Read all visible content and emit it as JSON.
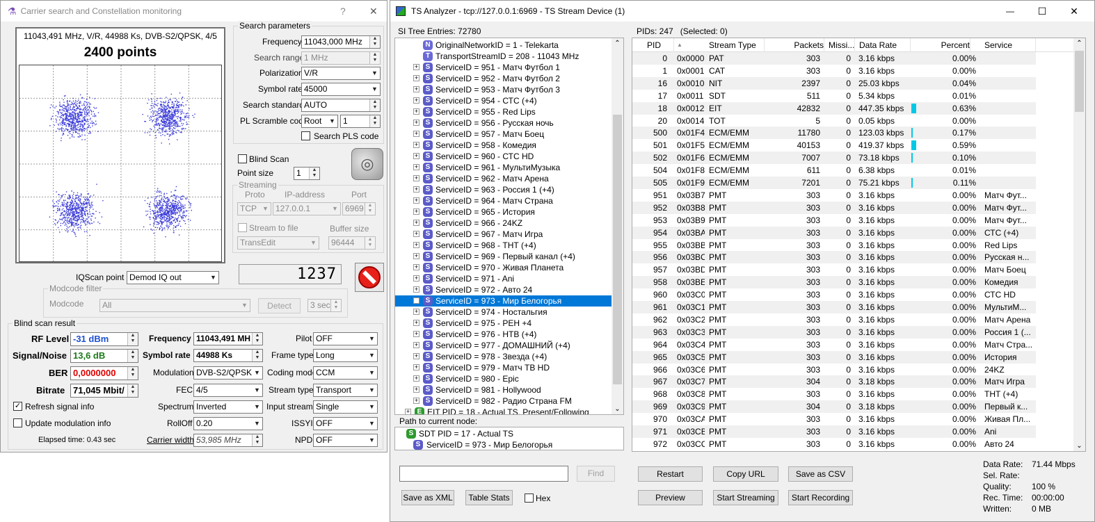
{
  "left": {
    "title": "Carrier search and Constellation monitoring",
    "help": "?",
    "close": "✕",
    "constellation": {
      "info": "11043,491 MHz, V/R, 44988 Ks, DVB-S2/QPSK, 4/5",
      "points": "2400 points"
    },
    "search": {
      "legend": "Search parameters",
      "frequency_label": "Frequency",
      "frequency_value": "11043,000 MHz",
      "range_label": "Search range",
      "range_value": "1 MHz",
      "polarization_label": "Polarization",
      "polarization_value": "V/R",
      "symbol_rate_label": "Symbol rate",
      "symbol_rate_value": "45000",
      "standard_label": "Search standard",
      "standard_value": "AUTO",
      "pl_label": "PL Scramble code",
      "pl_mode": "Root",
      "pl_value": "1",
      "pls_label": "Search PLS code"
    },
    "blind_scan_label": "Blind Scan",
    "point_size_label": "Point size",
    "point_size_value": "1",
    "streaming": {
      "legend": "Streaming",
      "proto_label": "Proto",
      "ip_label": "IP-address",
      "port_label": "Port",
      "proto_value": "TCP",
      "ip_value": "127.0.0.1",
      "port_value": "6969",
      "stream_to_file_label": "Stream to file",
      "buffer_label": "Buffer size",
      "file_value": "TransEdit",
      "buffer_value": "96444"
    },
    "counter": "1237",
    "iqscan_label": "IQScan point",
    "iqscan_value": "Demod IQ out",
    "modcode": {
      "legend": "Modcode filter",
      "label": "Modcode",
      "value": "All",
      "detect": "Detect",
      "secs": "3 sec"
    },
    "result": {
      "legend": "Blind scan result",
      "rf_label": "RF Level",
      "rf_value": "-31 dBm",
      "snr_label": "Signal/Noise",
      "snr_value": "13,6 dB",
      "ber_label": "BER",
      "ber_value": "0,0000000",
      "bitrate_label": "Bitrate",
      "bitrate_value": "71,045 Mbit/",
      "freq_label": "Frequency",
      "freq_value": "11043,491 MH",
      "sr_label": "Symbol rate",
      "sr_value": "44988 Ks",
      "mod_label": "Modulation",
      "mod_value": "DVB-S2/QPSK",
      "fec_label": "FEC",
      "fec_value": "4/5",
      "spectrum_label": "Spectrum",
      "spectrum_value": "Inverted",
      "rolloff_label": "RollOff",
      "rolloff_value": "0.20",
      "width_label": "Carrier width",
      "width_value": "53,985 MHz",
      "pilot_label": "Pilot",
      "pilot_value": "OFF",
      "frame_label": "Frame type",
      "frame_value": "Long",
      "coding_label": "Coding mode",
      "coding_value": "CCM",
      "stype_label": "Stream type",
      "stype_value": "Transport",
      "input_label": "Input stream",
      "input_value": "Single",
      "issyi_label": "ISSYI",
      "issyi_value": "OFF",
      "npd_label": "NPD",
      "npd_value": "OFF",
      "refresh_label": "Refresh signal info",
      "update_label": "Update modulation info",
      "elapsed": "Elapsed time: 0.43 sec"
    }
  },
  "right": {
    "title": "TS Analyzer - tcp://127.0.0.1:6969 - TS Stream Device (1)",
    "minimize": "—",
    "maximize": "☐",
    "close": "✕",
    "tree_header": "SI Tree Entries: 72780",
    "pids_header": "PIDs: 247   (Selected: 0)",
    "tree": [
      {
        "icon": "N",
        "text": "OriginalNetworkID = 1 - Telekarta",
        "exp": false
      },
      {
        "icon": "T",
        "text": "TransportStreamID = 208 - 11043 MHz",
        "exp": false
      },
      {
        "icon": "S",
        "text": "ServiceID = 951 - Матч Футбол 1",
        "exp": true
      },
      {
        "icon": "S",
        "text": "ServiceID = 952 - Матч Футбол 2",
        "exp": true
      },
      {
        "icon": "S",
        "text": "ServiceID = 953 - Матч Футбол 3",
        "exp": true
      },
      {
        "icon": "S",
        "text": "ServiceID = 954 - СТС (+4)",
        "exp": true
      },
      {
        "icon": "S",
        "text": "ServiceID = 955 - Red Lips",
        "exp": true
      },
      {
        "icon": "S",
        "text": "ServiceID = 956 - Русская ночь",
        "exp": true
      },
      {
        "icon": "S",
        "text": "ServiceID = 957 - Матч Боец",
        "exp": true
      },
      {
        "icon": "S",
        "text": "ServiceID = 958 - Комедия",
        "exp": true
      },
      {
        "icon": "S",
        "text": "ServiceID = 960 - СТС HD",
        "exp": true
      },
      {
        "icon": "S",
        "text": "ServiceID = 961 - МультиМузыка",
        "exp": true
      },
      {
        "icon": "S",
        "text": "ServiceID = 962 - Матч Арена",
        "exp": true
      },
      {
        "icon": "S",
        "text": "ServiceID = 963 - Россия 1 (+4)",
        "exp": true
      },
      {
        "icon": "S",
        "text": "ServiceID = 964 - Матч Страна",
        "exp": true
      },
      {
        "icon": "S",
        "text": "ServiceID = 965 - История",
        "exp": true
      },
      {
        "icon": "S",
        "text": "ServiceID = 966 - 24KZ",
        "exp": true
      },
      {
        "icon": "S",
        "text": "ServiceID = 967 - Матч Игра",
        "exp": true
      },
      {
        "icon": "S",
        "text": "ServiceID = 968 - ТНТ (+4)",
        "exp": true
      },
      {
        "icon": "S",
        "text": "ServiceID = 969 - Первый канал (+4)",
        "exp": true
      },
      {
        "icon": "S",
        "text": "ServiceID = 970 - Живая Планета",
        "exp": true
      },
      {
        "icon": "S",
        "text": "ServiceID = 971 - Ani",
        "exp": true
      },
      {
        "icon": "S",
        "text": "ServiceID = 972 - Авто 24",
        "exp": true
      },
      {
        "icon": "S",
        "text": "ServiceID = 973 - Мир Белогорья",
        "exp": true,
        "selected": true
      },
      {
        "icon": "S",
        "text": "ServiceID = 974 - Ностальгия",
        "exp": true
      },
      {
        "icon": "S",
        "text": "ServiceID = 975 - РЕН +4",
        "exp": true
      },
      {
        "icon": "S",
        "text": "ServiceID = 976 - НТВ (+4)",
        "exp": true
      },
      {
        "icon": "S",
        "text": "ServiceID = 977 - ДОМАШНИЙ (+4)",
        "exp": true
      },
      {
        "icon": "S",
        "text": "ServiceID = 978 - Звезда (+4)",
        "exp": true
      },
      {
        "icon": "S",
        "text": "ServiceID = 979 - Матч ТВ HD",
        "exp": true
      },
      {
        "icon": "S",
        "text": "ServiceID = 980 - Epic",
        "exp": true
      },
      {
        "icon": "S",
        "text": "ServiceID = 981 - Hollywood",
        "exp": true
      },
      {
        "icon": "S",
        "text": "ServiceID = 982 - Радио Страна FM",
        "exp": true
      },
      {
        "icon": "E",
        "text": "EIT PID = 18 - Actual TS, Present/Following",
        "exp": true,
        "eit": true
      }
    ],
    "path_label": "Path to current node:",
    "path": [
      "SDT PID = 17 - Actual TS",
      "ServiceID = 973 - Мир Белогорья"
    ],
    "columns": [
      "PID",
      "",
      "Stream Type",
      "Packets",
      "Missi...",
      "Data Rate",
      "Percent",
      "Service"
    ],
    "rows": [
      [
        "0",
        "0x0000",
        "PAT",
        "303",
        "0",
        "3.16 kbps",
        "0.00%",
        "",
        0
      ],
      [
        "1",
        "0x0001",
        "CAT",
        "303",
        "0",
        "3.16 kbps",
        "0.00%",
        "",
        0
      ],
      [
        "16",
        "0x0010",
        "NIT",
        "2397",
        "0",
        "25.03 kbps",
        "0.04%",
        "",
        0
      ],
      [
        "17",
        "0x0011",
        "SDT",
        "511",
        "0",
        "5.34 kbps",
        "0.01%",
        "",
        0
      ],
      [
        "18",
        "0x0012",
        "EIT",
        "42832",
        "0",
        "447.35 kbps",
        "0.63%",
        "",
        0.63
      ],
      [
        "20",
        "0x0014",
        "TOT",
        "5",
        "0",
        "0.05 kbps",
        "0.00%",
        "",
        0
      ],
      [
        "500",
        "0x01F4",
        "ECM/EMM",
        "11780",
        "0",
        "123.03 kbps",
        "0.17%",
        "",
        0.17
      ],
      [
        "501",
        "0x01F5",
        "ECM/EMM",
        "40153",
        "0",
        "419.37 kbps",
        "0.59%",
        "",
        0.59
      ],
      [
        "502",
        "0x01F6",
        "ECM/EMM",
        "7007",
        "0",
        "73.18 kbps",
        "0.10%",
        "",
        0.1
      ],
      [
        "504",
        "0x01F8",
        "ECM/EMM",
        "611",
        "0",
        "6.38 kbps",
        "0.01%",
        "",
        0
      ],
      [
        "505",
        "0x01F9",
        "ECM/EMM",
        "7201",
        "0",
        "75.21 kbps",
        "0.11%",
        "",
        0.11
      ],
      [
        "951",
        "0x03B7",
        "PMT",
        "303",
        "0",
        "3.16 kbps",
        "0.00%",
        "Матч Фут...",
        0
      ],
      [
        "952",
        "0x03B8",
        "PMT",
        "303",
        "0",
        "3.16 kbps",
        "0.00%",
        "Матч Фут...",
        0
      ],
      [
        "953",
        "0x03B9",
        "PMT",
        "303",
        "0",
        "3.16 kbps",
        "0.00%",
        "Матч Фут...",
        0
      ],
      [
        "954",
        "0x03BA",
        "PMT",
        "303",
        "0",
        "3.16 kbps",
        "0.00%",
        "СТС (+4)",
        0
      ],
      [
        "955",
        "0x03BB",
        "PMT",
        "303",
        "0",
        "3.16 kbps",
        "0.00%",
        "Red Lips",
        0
      ],
      [
        "956",
        "0x03BC",
        "PMT",
        "303",
        "0",
        "3.16 kbps",
        "0.00%",
        "Русская н...",
        0
      ],
      [
        "957",
        "0x03BD",
        "PMT",
        "303",
        "0",
        "3.16 kbps",
        "0.00%",
        "Матч Боец",
        0
      ],
      [
        "958",
        "0x03BE",
        "PMT",
        "303",
        "0",
        "3.16 kbps",
        "0.00%",
        "Комедия",
        0
      ],
      [
        "960",
        "0x03C0",
        "PMT",
        "303",
        "0",
        "3.16 kbps",
        "0.00%",
        "СТС HD",
        0
      ],
      [
        "961",
        "0x03C1",
        "PMT",
        "303",
        "0",
        "3.16 kbps",
        "0.00%",
        "МультиМ...",
        0
      ],
      [
        "962",
        "0x03C2",
        "PMT",
        "303",
        "0",
        "3.16 kbps",
        "0.00%",
        "Матч Арена",
        0
      ],
      [
        "963",
        "0x03C3",
        "PMT",
        "303",
        "0",
        "3.16 kbps",
        "0.00%",
        "Россия 1 (...",
        0
      ],
      [
        "964",
        "0x03C4",
        "PMT",
        "303",
        "0",
        "3.16 kbps",
        "0.00%",
        "Матч Стра...",
        0
      ],
      [
        "965",
        "0x03C5",
        "PMT",
        "303",
        "0",
        "3.16 kbps",
        "0.00%",
        "История",
        0
      ],
      [
        "966",
        "0x03C6",
        "PMT",
        "303",
        "0",
        "3.16 kbps",
        "0.00%",
        "24KZ",
        0
      ],
      [
        "967",
        "0x03C7",
        "PMT",
        "304",
        "0",
        "3.18 kbps",
        "0.00%",
        "Матч Игра",
        0
      ],
      [
        "968",
        "0x03C8",
        "PMT",
        "303",
        "0",
        "3.16 kbps",
        "0.00%",
        "ТНТ (+4)",
        0
      ],
      [
        "969",
        "0x03C9",
        "PMT",
        "304",
        "0",
        "3.18 kbps",
        "0.00%",
        "Первый к...",
        0
      ],
      [
        "970",
        "0x03CA",
        "PMT",
        "303",
        "0",
        "3.16 kbps",
        "0.00%",
        "Живая Пл...",
        0
      ],
      [
        "971",
        "0x03CB",
        "PMT",
        "303",
        "0",
        "3.16 kbps",
        "0.00%",
        "Ani",
        0
      ],
      [
        "972",
        "0x03CC",
        "PMT",
        "303",
        "0",
        "3.16 kbps",
        "0.00%",
        "Авто 24",
        0
      ]
    ],
    "find_label": "Find",
    "save_xml": "Save as XML",
    "table_stats": "Table Stats",
    "hex_label": "Hex",
    "restart": "Restart",
    "copy_url": "Copy URL",
    "save_csv": "Save as CSV",
    "preview": "Preview",
    "start_streaming": "Start Streaming",
    "start_recording": "Start Recording",
    "stats": [
      {
        "label": "Data Rate:",
        "value": "71.44 Mbps"
      },
      {
        "label": "Sel. Rate:",
        "value": ""
      },
      {
        "label": "Quality:",
        "value": "100 %"
      },
      {
        "label": "Rec. Time:",
        "value": "00:00:00"
      },
      {
        "label": "Written:",
        "value": "0 MB"
      }
    ]
  },
  "colors": {
    "selection": "#0078d7",
    "service_icon": "#5b5bc9",
    "bar": "#00c8e6",
    "row_alt": "#f0f0f0",
    "rf_value": "#1e50d0",
    "snr_value": "#1a7a1a",
    "ber_value": "#e00000"
  }
}
